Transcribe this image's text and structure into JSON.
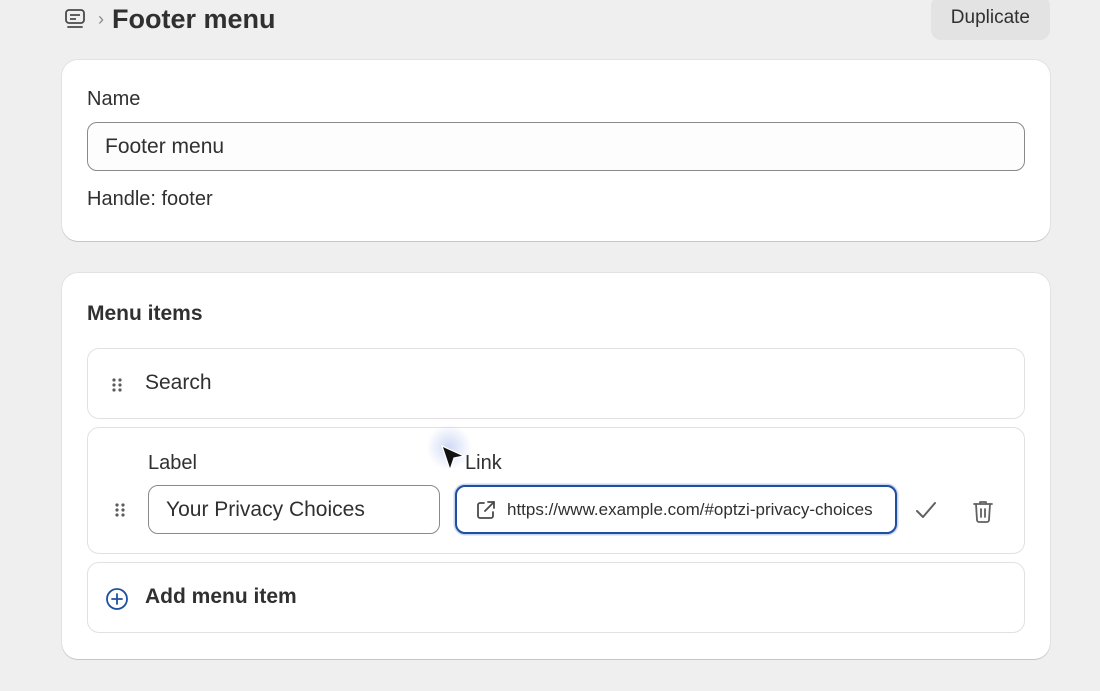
{
  "header": {
    "breadcrumb_sep": "›",
    "title": "Footer menu",
    "duplicate_label": "Duplicate",
    "menu_icon": "menu-icon"
  },
  "name_card": {
    "name_label": "Name",
    "name_value": "Footer menu",
    "handle_text": "Handle: footer"
  },
  "menu_card": {
    "title": "Menu items",
    "items": [
      {
        "label": "Search",
        "icon": "drag-handle-icon"
      }
    ],
    "editing": {
      "label_heading": "Label",
      "link_heading": "Link",
      "label_value": "Your Privacy Choices",
      "link_value": "https://www.example.com/#optzi-privacy-choices",
      "link_icon": "external-link-icon",
      "confirm_icon": "check-icon",
      "delete_icon": "trash-icon"
    },
    "add_item_label": "Add menu item",
    "add_icon": "plus-circle-icon"
  },
  "colors": {
    "background": "#efefef",
    "card": "#ffffff",
    "focus_border": "#1f4fa0",
    "text": "#303030",
    "muted": "#8a8a8a"
  }
}
